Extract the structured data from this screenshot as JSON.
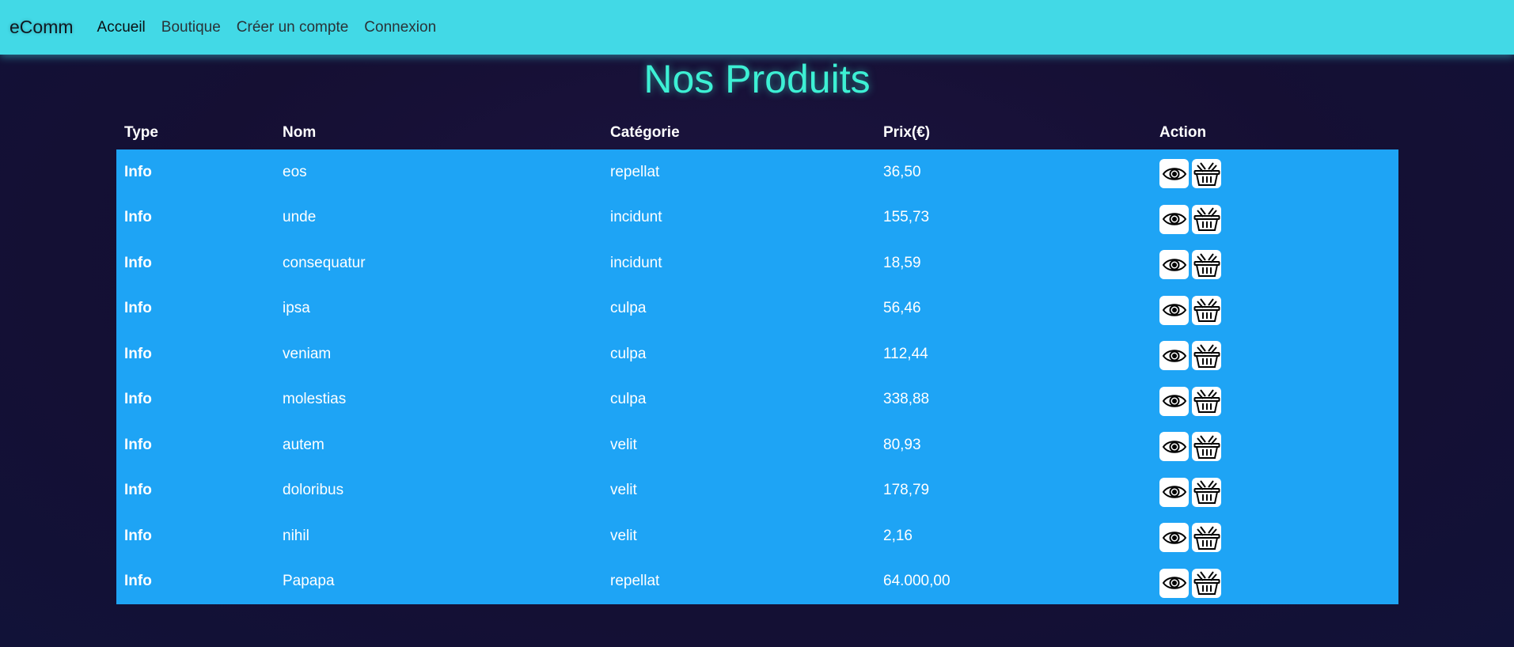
{
  "nav": {
    "brand": "eComm",
    "links": [
      {
        "label": "Accueil",
        "active": true
      },
      {
        "label": "Boutique",
        "active": false
      },
      {
        "label": "Créer un compte",
        "active": false
      },
      {
        "label": "Connexion",
        "active": false
      }
    ]
  },
  "title": "Nos Produits",
  "table": {
    "headers": {
      "type": "Type",
      "name": "Nom",
      "category": "Catégorie",
      "price": "Prix(€)",
      "action": "Action"
    },
    "rows": [
      {
        "type": "Info",
        "name": "eos",
        "category": "repellat",
        "price": "36,50"
      },
      {
        "type": "Info",
        "name": "unde",
        "category": "incidunt",
        "price": "155,73"
      },
      {
        "type": "Info",
        "name": "consequatur",
        "category": "incidunt",
        "price": "18,59"
      },
      {
        "type": "Info",
        "name": "ipsa",
        "category": "culpa",
        "price": "56,46"
      },
      {
        "type": "Info",
        "name": "veniam",
        "category": "culpa",
        "price": "112,44"
      },
      {
        "type": "Info",
        "name": "molestias",
        "category": "culpa",
        "price": "338,88"
      },
      {
        "type": "Info",
        "name": "autem",
        "category": "velit",
        "price": "80,93"
      },
      {
        "type": "Info",
        "name": "doloribus",
        "category": "velit",
        "price": "178,79"
      },
      {
        "type": "Info",
        "name": "nihil",
        "category": "velit",
        "price": "2,16"
      },
      {
        "type": "Info",
        "name": "Papapa",
        "category": "repellat",
        "price": "64.000,00"
      }
    ],
    "action_icons": [
      "eye-icon",
      "basket-icon"
    ]
  },
  "colors": {
    "navbar": "#42d9e6",
    "title": "#3df0d4",
    "row_background": "#1ea4f5",
    "page_background": "#150f33"
  }
}
